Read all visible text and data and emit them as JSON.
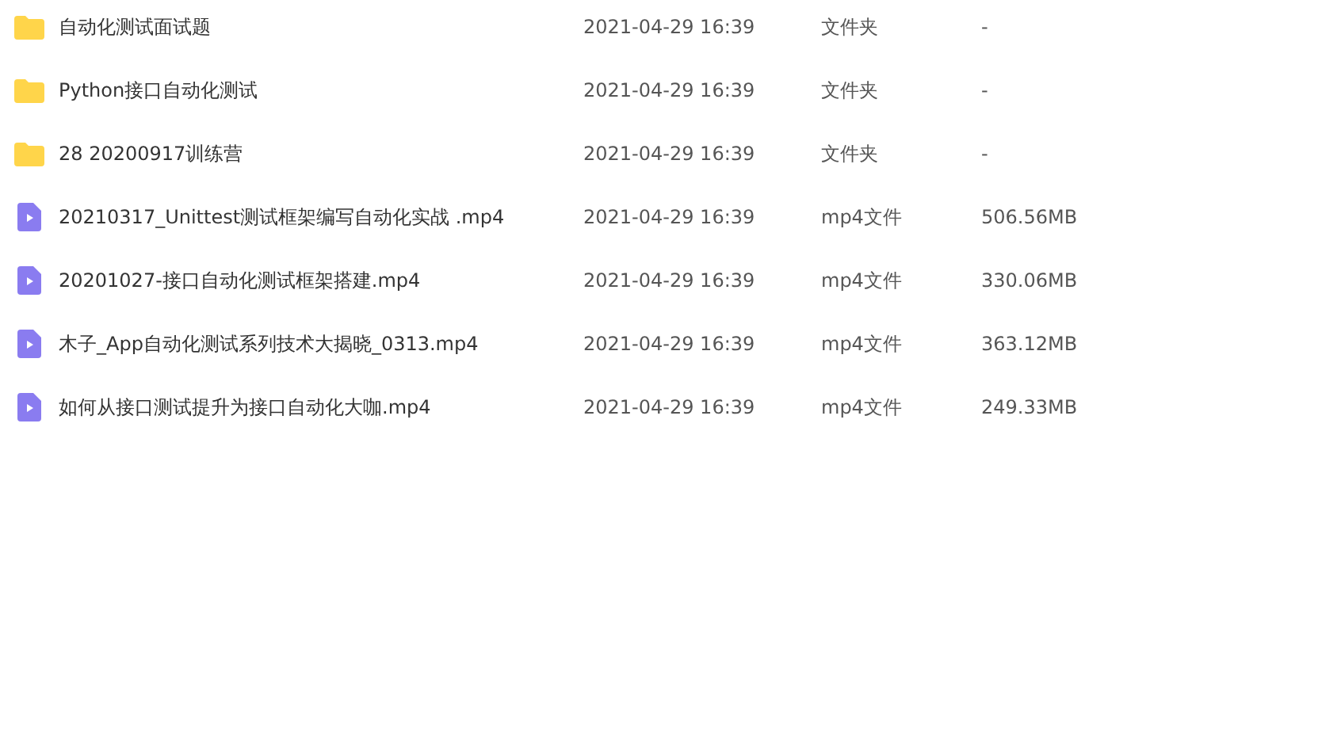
{
  "files": [
    {
      "kind": "folder",
      "name": "自动化测试面试题",
      "modified": "2021-04-29 16:39",
      "type": "文件夹",
      "size": "-"
    },
    {
      "kind": "folder",
      "name": "Python接口自动化测试",
      "modified": "2021-04-29 16:39",
      "type": "文件夹",
      "size": "-"
    },
    {
      "kind": "folder",
      "name": "28 20200917训练营",
      "modified": "2021-04-29 16:39",
      "type": "文件夹",
      "size": "-"
    },
    {
      "kind": "video",
      "name": "20210317_Unittest测试框架编写自动化实战 .mp4",
      "modified": "2021-04-29 16:39",
      "type": "mp4文件",
      "size": "506.56MB"
    },
    {
      "kind": "video",
      "name": "20201027-接口自动化测试框架搭建.mp4",
      "modified": "2021-04-29 16:39",
      "type": "mp4文件",
      "size": "330.06MB"
    },
    {
      "kind": "video",
      "name": "木子_App自动化测试系列技术大揭晓_0313.mp4",
      "modified": "2021-04-29 16:39",
      "type": "mp4文件",
      "size": "363.12MB"
    },
    {
      "kind": "video",
      "name": "如何从接口测试提升为接口自动化大咖.mp4",
      "modified": "2021-04-29 16:39",
      "type": "mp4文件",
      "size": "249.33MB"
    }
  ]
}
